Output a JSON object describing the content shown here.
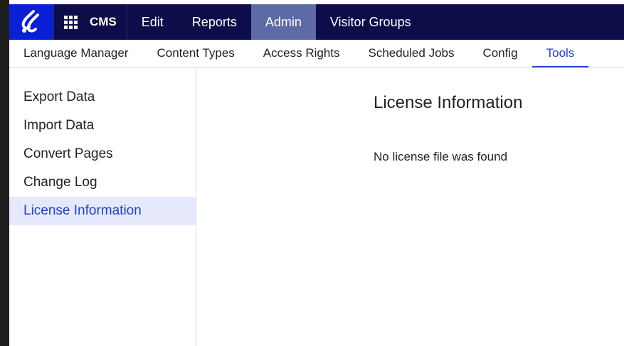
{
  "topnav": {
    "logo_icon": "optimizely-logo-icon",
    "apps_icon": "grid-icon",
    "product": "CMS",
    "items": [
      {
        "label": "Edit",
        "active": false
      },
      {
        "label": "Reports",
        "active": false
      },
      {
        "label": "Admin",
        "active": true
      },
      {
        "label": "Visitor Groups",
        "active": false
      }
    ]
  },
  "subnav": {
    "items": [
      {
        "label": "Language Manager",
        "active": false
      },
      {
        "label": "Content Types",
        "active": false
      },
      {
        "label": "Access Rights",
        "active": false
      },
      {
        "label": "Scheduled Jobs",
        "active": false
      },
      {
        "label": "Config",
        "active": false
      },
      {
        "label": "Tools",
        "active": true
      }
    ]
  },
  "sidebar": {
    "items": [
      {
        "label": "Export Data",
        "active": false
      },
      {
        "label": "Import Data",
        "active": false
      },
      {
        "label": "Convert Pages",
        "active": false
      },
      {
        "label": "Change Log",
        "active": false
      },
      {
        "label": "License Information",
        "active": true
      }
    ]
  },
  "main": {
    "title": "License Information",
    "message": "No license file was found"
  },
  "colors": {
    "topnav_bg": "#0d0d4a",
    "logo_bg": "#0a1fd6",
    "active_top_bg": "#5d6aa8",
    "accent": "#1f3fd6",
    "active_side_bg": "#e5e9fb"
  }
}
